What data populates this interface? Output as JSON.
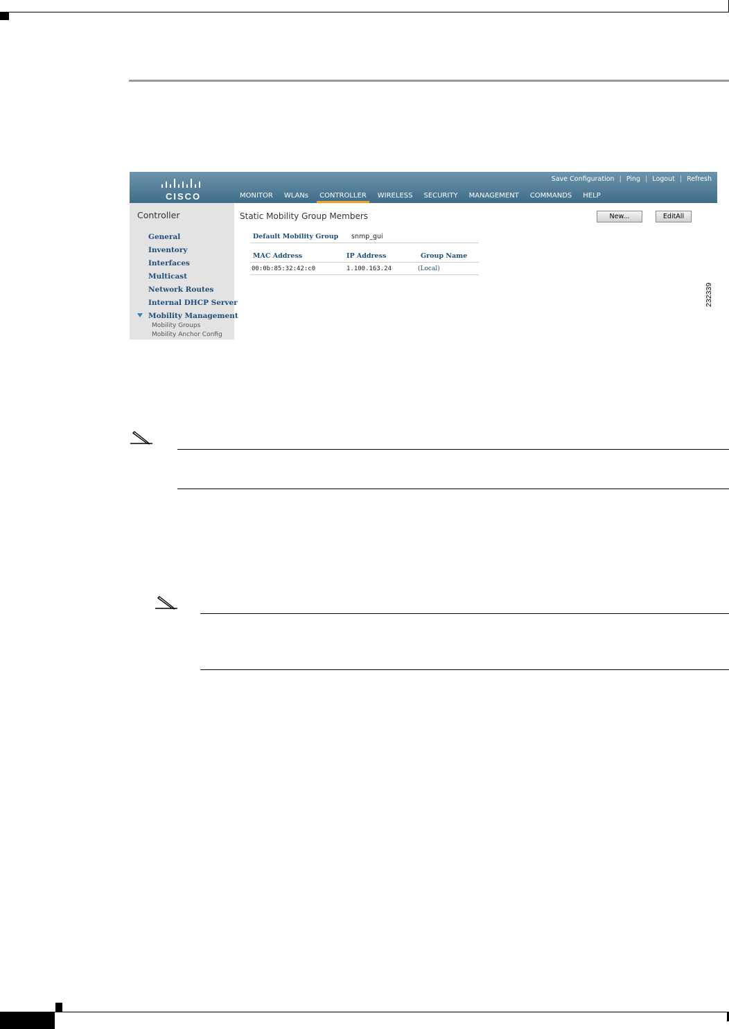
{
  "screenshot": {
    "util_links": {
      "save": "Save Configuration",
      "ping": "Ping",
      "logout": "Logout",
      "refresh": "Refresh"
    },
    "logo_text": "CISCO",
    "menu": [
      "MONITOR",
      "WLANs",
      "CONTROLLER",
      "WIRELESS",
      "SECURITY",
      "MANAGEMENT",
      "COMMANDS",
      "HELP"
    ],
    "active_menu": "CONTROLLER",
    "sidebar": {
      "title": "Controller",
      "items": [
        "General",
        "Inventory",
        "Interfaces",
        "Multicast",
        "Network Routes",
        "Internal DHCP Server",
        "Mobility Management"
      ],
      "subitems": [
        "Mobility Groups",
        "Mobility Anchor Config"
      ]
    },
    "content": {
      "title": "Static Mobility Group Members",
      "buttons": {
        "new": "New...",
        "edit_all": "EditAll"
      },
      "default_group_label": "Default Mobility Group",
      "default_group_value": "snmp_gui",
      "columns": [
        "MAC Address",
        "IP Address",
        "Group Name"
      ],
      "rows": [
        [
          "00:0b:85:32:42:c0",
          "1.100.163.24",
          "(Local)"
        ]
      ]
    },
    "figure_number": "232339"
  },
  "colors": {
    "header_top": "#6d94ac",
    "header_bottom": "#3f6c89",
    "active_tab": "#f7a01a",
    "link_blue": "#1f4d7a",
    "sidebar_bg": "#e3e3e3"
  }
}
